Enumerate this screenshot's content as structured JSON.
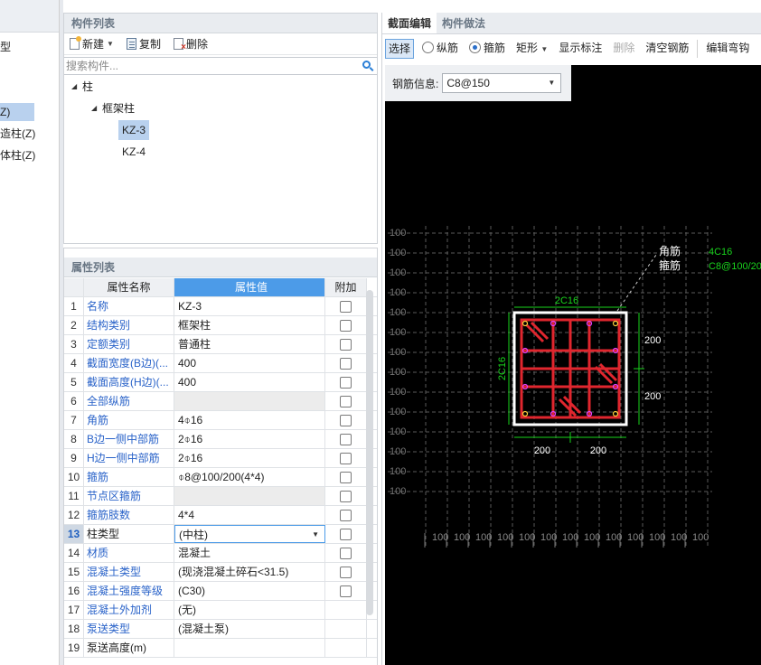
{
  "left_sliver": {
    "items": [
      "型",
      "Z)",
      "造柱(Z)",
      "体柱(Z)"
    ]
  },
  "component_list": {
    "title": "构件列表",
    "toolbar": {
      "new_label": "新建",
      "copy_label": "复制",
      "delete_label": "删除"
    },
    "search_placeholder": "搜索构件...",
    "tree": {
      "root": "柱",
      "group": "框架柱",
      "leaves": [
        "KZ-3",
        "KZ-4"
      ]
    }
  },
  "property_list": {
    "title": "属性列表",
    "headers": {
      "name": "属性名称",
      "value": "属性值",
      "add": "附加"
    },
    "rows": [
      {
        "idx": "1",
        "name": "名称",
        "value": "KZ-3"
      },
      {
        "idx": "2",
        "name": "结构类别",
        "value": "框架柱"
      },
      {
        "idx": "3",
        "name": "定额类别",
        "value": "普通柱"
      },
      {
        "idx": "4",
        "name": "截面宽度(B边)(...",
        "value": "400"
      },
      {
        "idx": "5",
        "name": "截面高度(H边)(...",
        "value": "400"
      },
      {
        "idx": "6",
        "name": "全部纵筋",
        "value": ""
      },
      {
        "idx": "7",
        "name": "角筋",
        "value": "4⌽16"
      },
      {
        "idx": "8",
        "name": "B边一侧中部筋",
        "value": "2⌽16"
      },
      {
        "idx": "9",
        "name": "H边一侧中部筋",
        "value": "2⌽16"
      },
      {
        "idx": "10",
        "name": "箍筋",
        "value": "⌽8@100/200(4*4)"
      },
      {
        "idx": "11",
        "name": "节点区箍筋",
        "value": ""
      },
      {
        "idx": "12",
        "name": "箍筋肢数",
        "value": "4*4"
      },
      {
        "idx": "13",
        "name": "柱类型",
        "value": "(中柱)"
      },
      {
        "idx": "14",
        "name": "材质",
        "value": "混凝土"
      },
      {
        "idx": "15",
        "name": "混凝土类型",
        "value": "(现浇混凝土碎石<31.5)"
      },
      {
        "idx": "16",
        "name": "混凝土强度等级",
        "value": "(C30)"
      },
      {
        "idx": "17",
        "name": "混凝土外加剂",
        "value": "(无)"
      },
      {
        "idx": "18",
        "name": "泵送类型",
        "value": "(混凝土泵)"
      },
      {
        "idx": "19",
        "name": "泵送高度(m)",
        "value": ""
      }
    ]
  },
  "section_editor": {
    "tabs": [
      "截面编辑",
      "构件做法"
    ],
    "toolbar": {
      "select": "选择",
      "longitudinal": "纵筋",
      "stirrup": "箍筋",
      "shape": "矩形",
      "show_annotation": "显示标注",
      "delete": "删除",
      "clear_rebar": "清空钢筋",
      "edit_hook": "编辑弯钩"
    },
    "rebar_info_label": "钢筋信息:",
    "rebar_info_value": "C8@150",
    "drawing": {
      "grid_label": "100",
      "top_note_label": "2C16",
      "left_note_label": "2C16",
      "dim_right_1": "200",
      "dim_right_2": "200",
      "dim_bottom_1": "200",
      "dim_bottom_2": "200",
      "callout_corner": "角筋",
      "callout_stirrup": "箍筋",
      "callout_corner_value": "4C16",
      "callout_stirrup_value": "C8@100/20",
      "colors": {
        "rebar": "#e0262e",
        "dim": "#19d31d",
        "concrete": "#ffffff",
        "grid": "#5a5a5a"
      }
    }
  }
}
